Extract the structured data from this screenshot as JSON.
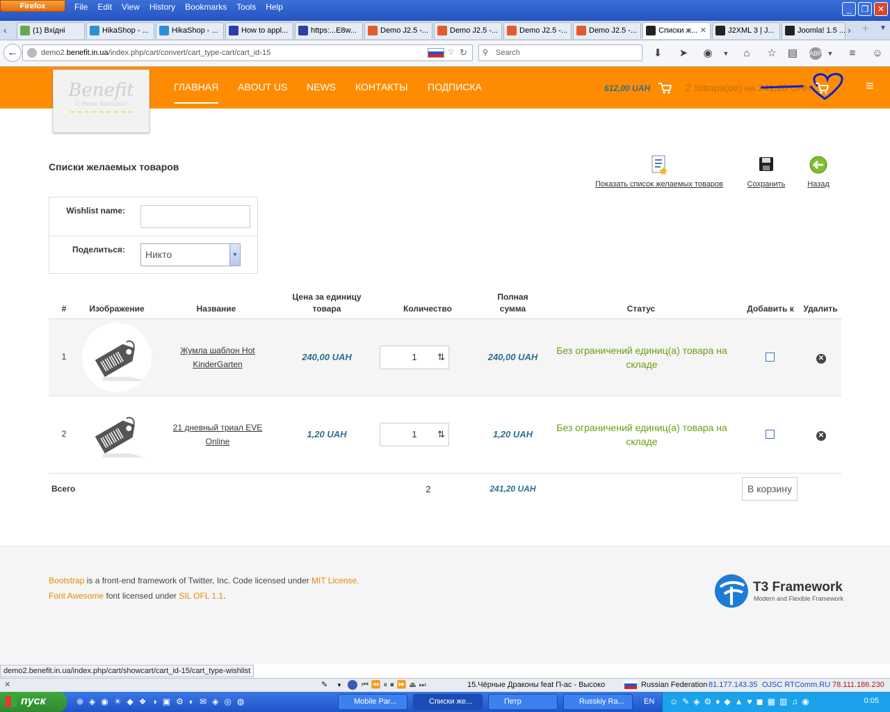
{
  "browser": {
    "app_button": "Firefox",
    "menu": [
      "File",
      "Edit",
      "View",
      "History",
      "Bookmarks",
      "Tools",
      "Help"
    ],
    "tabs": [
      {
        "label": "(1) Вхідні",
        "color": "#6aa84f"
      },
      {
        "label": "HikaShop - ...",
        "color": "#2b8fd6"
      },
      {
        "label": "HikaShop - ...",
        "color": "#2b8fd6"
      },
      {
        "label": "How to appl...",
        "color": "#2a3fa8"
      },
      {
        "label": "https:...E8w...",
        "color": "#2a3fa8"
      },
      {
        "label": "Demo J2.5 -...",
        "color": "#e35b2a"
      },
      {
        "label": "Demo J2.5 -...",
        "color": "#e35b2a"
      },
      {
        "label": "Demo J2.5 -...",
        "color": "#e35b2a"
      },
      {
        "label": "Demo J2.5 -...",
        "color": "#e35b2a"
      },
      {
        "label": "Списки ж...",
        "color": "#222"
      },
      {
        "label": "J2XML 3 | J...",
        "color": "#222"
      },
      {
        "label": "Joomla! 1.5 ...",
        "color": "#222"
      }
    ],
    "url_host": "demo2.benefit.in.ua",
    "url_path": "/index.php/cart/convert/cart_type-cart/cart_id-15",
    "url_prefix": "demo2.",
    "url_domain": "benefit.in.ua",
    "search_placeholder": "Search",
    "status_url": "demo2.benefit.in.ua/index.php/cart/showcart/cart_id-15/cart_type-wishlist"
  },
  "site": {
    "logo_title": "Benefit",
    "logo_sub": "С Нами Выгодно!",
    "nav": [
      "ГЛАВНАЯ",
      "ABOUT US",
      "NEWS",
      "КОНТАКТЫ",
      "ПОДПИСКА"
    ],
    "cart_total": "612,00 UAH",
    "cart_info": "2 товара(ов) на 241,20 UAH"
  },
  "page": {
    "title": "Списки желаемых товаров",
    "toolbar": {
      "show": "Показать список желаемых товаров",
      "save": "Сохранить",
      "back": "Назад"
    },
    "form": {
      "name_label": "Wishlist name:",
      "name_value": "",
      "share_label": "Поделиться:",
      "share_value": "Никто"
    },
    "table": {
      "headers": [
        "#",
        "Изображение",
        "Название",
        "Цена за единицу товара",
        "Количество",
        "Полная сумма",
        "Статус",
        "Добавить к",
        "Удалить"
      ],
      "header_price_1": "Цена за единицу",
      "header_price_2": "товара",
      "header_total_1": "Полная",
      "header_total_2": "сумма",
      "rows": [
        {
          "num": "1",
          "name_1": "Жумла шаблон Hot",
          "name_2": "KinderGarten",
          "price": "240,00 UAH",
          "qty": "1",
          "total": "240,00 UAH",
          "status_1": "Без ограничений единиц(а) товара на",
          "status_2": "складе"
        },
        {
          "num": "2",
          "name_1": "21 дневный триал EVE",
          "name_2": "Online",
          "price": "1,20 UAH",
          "qty": "1",
          "total": "1,20 UAH",
          "status_1": "Без ограничений единиц(а) товара на",
          "status_2": "складе"
        }
      ],
      "footer": {
        "label": "Всего",
        "qty": "2",
        "total": "241,20 UAH",
        "button": "В корзину"
      }
    }
  },
  "footer": {
    "bootstrap": "Bootstrap",
    "line1_mid": " is a front-end framework of Twitter, Inc. Code licensed under ",
    "mit": "MIT License",
    "dot": ".",
    "fontawesome": "Font Awesome",
    "line2_mid": " font licensed under ",
    "ofl": "SIL OFL 1.1",
    "t3_title": "T3 Framework",
    "t3_sub": "Modern and Flexible Framework"
  },
  "player": {
    "track": "15.Чёрные Драконы feat П-ас - Высоко",
    "country": "Russian Federation",
    "ip1": "81.177.143.35",
    "isp": "OJSC RTComm.RU",
    "ip2": "78.111.186.230"
  },
  "taskbar": {
    "start": "пуск",
    "tasks": [
      "Mobile Par...",
      "Списки же...",
      "Петр",
      "Russkiy Ra..."
    ],
    "lang": "EN",
    "clock": "0:05"
  }
}
